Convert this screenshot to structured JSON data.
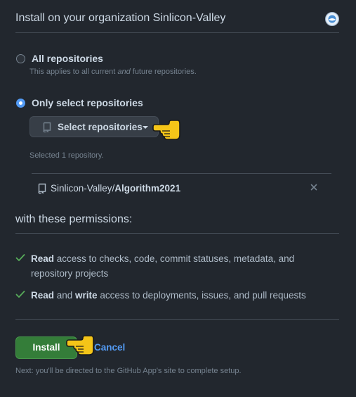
{
  "header": {
    "title": "Install on your organization Sinlicon-Valley"
  },
  "options": {
    "all": {
      "label": "All repositories",
      "desc_before": "This applies to all current ",
      "desc_em": "and",
      "desc_after": " future repositories.",
      "selected": false
    },
    "select": {
      "label": "Only select repositories",
      "selected": true,
      "button_label": "Select repositories"
    }
  },
  "selected_count": "Selected 1 repository.",
  "repos": [
    {
      "owner": "Sinlicon-Valley/",
      "name": "Algorithm2021"
    }
  ],
  "permissions": {
    "title": "with these permissions:",
    "items": [
      {
        "read": "Read",
        "text": " access to checks, code, commit statuses, metadata, and repository projects"
      },
      {
        "read": "Read",
        "and": " and ",
        "write": "write",
        "text": " access to deployments, issues, and pull requests"
      }
    ]
  },
  "actions": {
    "install_label": "Install",
    "cancel_label": "Cancel",
    "footnote": "Next: you'll be directed to the GitHub App's site to complete setup."
  },
  "colors": {
    "background": "#22272e",
    "accent_blue": "#539bf5",
    "install_green": "#347d39",
    "check_green": "#57ab5a",
    "pointer_yellow": "#f5c518"
  },
  "icons": {
    "repo": "repo-icon",
    "check": "check-icon",
    "close": "x-icon",
    "pointer": "pointing-hand-icon",
    "caret": "triangle-down-icon"
  }
}
